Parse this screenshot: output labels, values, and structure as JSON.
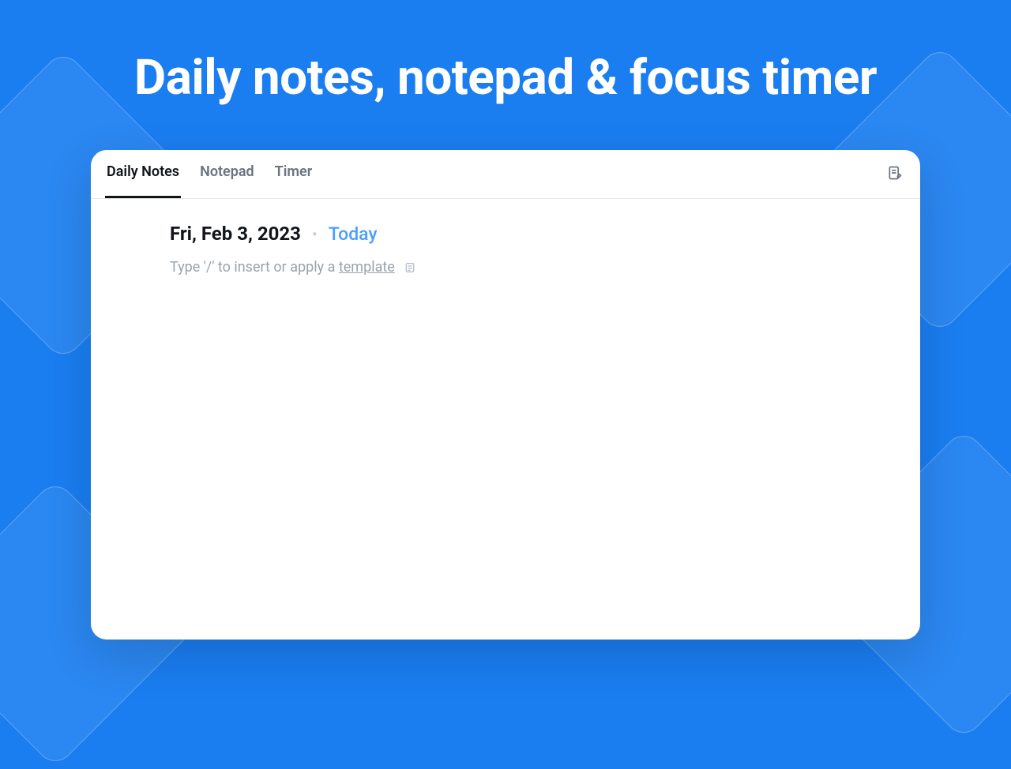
{
  "hero": {
    "title": "Daily notes, notepad & focus timer"
  },
  "tabs": [
    {
      "label": "Daily Notes",
      "active": true
    },
    {
      "label": "Notepad",
      "active": false
    },
    {
      "label": "Timer",
      "active": false
    }
  ],
  "header": {
    "notes_icon": "notes-edit-icon"
  },
  "note": {
    "date": "Fri, Feb 3, 2023",
    "dot": "•",
    "today_label": "Today",
    "prompt_prefix": "Type '/' to insert or apply a ",
    "template_label": "template",
    "template_icon": "template-icon"
  }
}
